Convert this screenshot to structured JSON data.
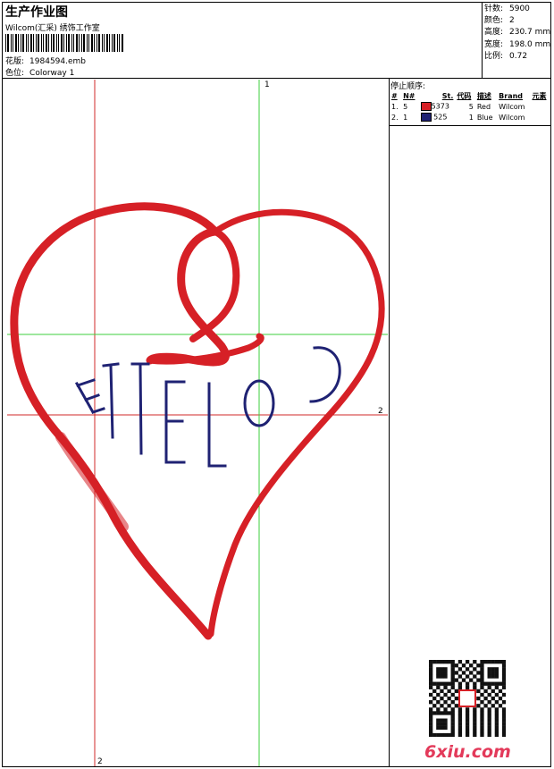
{
  "header": {
    "title": "生产作业图",
    "subtitle": "Wilcom(汇采) 绣饰工作室",
    "pattern_label": "花版:",
    "pattern_value": "1984594.emb",
    "colorway_label": "色位:",
    "colorway_value": "Colorway 1"
  },
  "stats": [
    {
      "label": "针数:",
      "value": "5900"
    },
    {
      "label": "颜色:",
      "value": "2"
    },
    {
      "label": "高度:",
      "value": "230.7 mm"
    },
    {
      "label": "宽度:",
      "value": "198.0 mm"
    },
    {
      "label": "比例:",
      "value": "0.72"
    }
  ],
  "stop_sequence": {
    "title": "停止顺序:",
    "headers": [
      "#",
      "N#",
      "St.",
      "代码",
      "描述",
      "Brand",
      "元素"
    ],
    "rows": [
      {
        "idx": "1.",
        "n": "5",
        "color": "#d62026",
        "st": "5373",
        "code": "5",
        "desc": "Red",
        "brand": "Wilcom",
        "elem": ""
      },
      {
        "idx": "2.",
        "n": "1",
        "color": "#1f2273",
        "st": "525",
        "code": "1",
        "desc": "Blue",
        "brand": "Wilcom",
        "elem": ""
      }
    ]
  },
  "canvas": {
    "axis_top": "1",
    "axis_right": "2",
    "axis_bottom": "2",
    "text": "COLETTE",
    "thread_red": "#d62026",
    "thread_blue": "#1f2273",
    "guide_red": "#d12a2a",
    "guide_green": "#3ccf3c"
  },
  "watermark": {
    "brand": "6xiu.com",
    "qr_icon": "qr-code-icon"
  }
}
